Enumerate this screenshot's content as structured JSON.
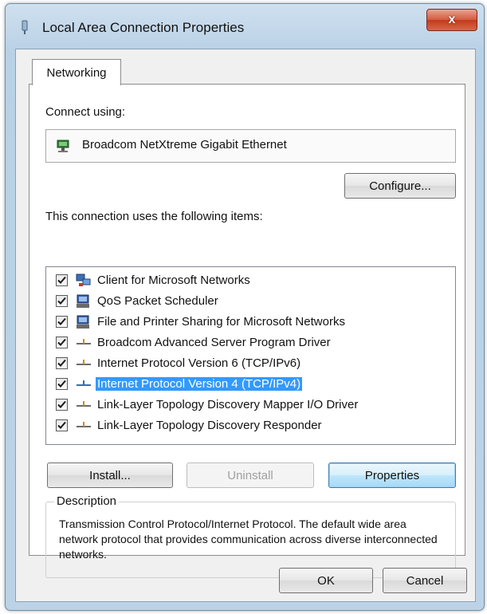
{
  "window": {
    "title": "Local Area Connection Properties",
    "close_label": "x"
  },
  "tabs": [
    {
      "label": "Networking",
      "active": true
    }
  ],
  "connect_using": {
    "label": "Connect using:",
    "adapter": "Broadcom NetXtreme Gigabit Ethernet",
    "configure_label": "Configure..."
  },
  "items_section": {
    "label": "This connection uses the following items:",
    "items": [
      {
        "label": "Client for Microsoft Networks",
        "checked": true,
        "icon": "network-client-icon",
        "selected": false
      },
      {
        "label": "QoS Packet Scheduler",
        "checked": true,
        "icon": "network-service-icon",
        "selected": false
      },
      {
        "label": "File and Printer Sharing for Microsoft Networks",
        "checked": true,
        "icon": "network-service-icon",
        "selected": false
      },
      {
        "label": "Broadcom Advanced Server Program Driver",
        "checked": true,
        "icon": "protocol-icon",
        "selected": false
      },
      {
        "label": "Internet Protocol Version 6 (TCP/IPv6)",
        "checked": true,
        "icon": "protocol-icon",
        "selected": false
      },
      {
        "label": "Internet Protocol Version 4 (TCP/IPv4)",
        "checked": true,
        "icon": "protocol-icon",
        "selected": true
      },
      {
        "label": "Link-Layer Topology Discovery Mapper I/O Driver",
        "checked": true,
        "icon": "protocol-icon",
        "selected": false
      },
      {
        "label": "Link-Layer Topology Discovery Responder",
        "checked": true,
        "icon": "protocol-icon",
        "selected": false
      }
    ]
  },
  "actions": {
    "install_label": "Install...",
    "uninstall_label": "Uninstall",
    "properties_label": "Properties"
  },
  "description": {
    "legend": "Description",
    "text": "Transmission Control Protocol/Internet Protocol. The default wide area network protocol that provides communication across diverse interconnected networks."
  },
  "footer": {
    "ok_label": "OK",
    "cancel_label": "Cancel"
  },
  "colors": {
    "selection": "#3399ff",
    "close_button": "#c23b1c",
    "title_bar": "#b9d1e6"
  }
}
